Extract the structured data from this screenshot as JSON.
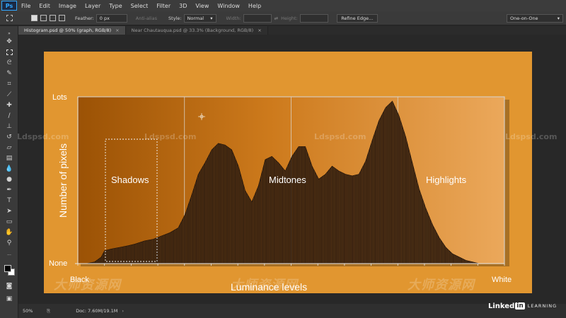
{
  "app": {
    "logo_text": "Ps"
  },
  "menu": [
    "File",
    "Edit",
    "Image",
    "Layer",
    "Type",
    "Select",
    "Filter",
    "3D",
    "View",
    "Window",
    "Help"
  ],
  "options": {
    "feather_label": "Feather:",
    "feather_value": "0 px",
    "antialias_label": "Anti-alias",
    "style_label": "Style:",
    "style_value": "Normal",
    "width_label": "Width:",
    "height_label": "Height:",
    "refine_edge_label": "Refine Edge...",
    "workspace_value": "One-on-One"
  },
  "tabs": [
    {
      "label": "Histogram.psd @ 50% (graph, RGB/8)"
    },
    {
      "label": "Near Chautauqua.psd @ 33.3% (Background, RGB/8)"
    }
  ],
  "status": {
    "zoom": "50%",
    "doc_info": "Doc: 7.60M/19.1M"
  },
  "watermarks": {
    "site": "Ldspsd.com",
    "cjk": "大师资源网"
  },
  "brand": {
    "linked": "Linked",
    "in": "in",
    "learning": "LEARNING"
  },
  "colors": {
    "canvas_bg": "#e19630",
    "histogram_fill": "#2b1a0e",
    "chart_bg_dark": "#9b5205",
    "chart_bg_light": "#eba85b"
  },
  "chart_data": {
    "type": "area",
    "x_labels": [
      "Black",
      "White"
    ],
    "y_labels": [
      "None",
      "Lots"
    ],
    "xlabel": "Luminance levels",
    "ylabel": "Number of pixels",
    "grid": true,
    "regions": [
      "Shadows",
      "Midtones",
      "Highlights"
    ],
    "x": [
      0,
      5,
      10,
      14,
      16,
      20,
      25,
      30,
      34,
      40,
      45,
      50,
      55,
      60,
      64,
      68,
      72,
      76,
      80,
      84,
      88,
      92,
      96,
      100,
      104,
      108,
      112,
      116,
      120,
      124,
      128,
      132,
      136,
      140,
      144,
      148,
      152,
      156,
      160,
      164,
      168,
      172,
      176,
      180,
      184,
      188,
      192,
      196,
      200,
      204,
      208,
      212,
      216,
      220,
      224,
      228,
      232,
      236,
      240,
      244,
      248,
      255
    ],
    "values": [
      0,
      0,
      1,
      4,
      8,
      9,
      10,
      11,
      12,
      14,
      15,
      17,
      19,
      22,
      30,
      42,
      55,
      62,
      70,
      74,
      73,
      70,
      60,
      45,
      38,
      48,
      64,
      66,
      62,
      57,
      66,
      72,
      72,
      60,
      52,
      55,
      60,
      57,
      55,
      54,
      55,
      63,
      76,
      88,
      96,
      100,
      91,
      78,
      62,
      46,
      34,
      24,
      16,
      10,
      6,
      4,
      2,
      1,
      0,
      0,
      0,
      0
    ],
    "ylim": [
      0,
      100
    ],
    "xlim": [
      0,
      255
    ]
  }
}
